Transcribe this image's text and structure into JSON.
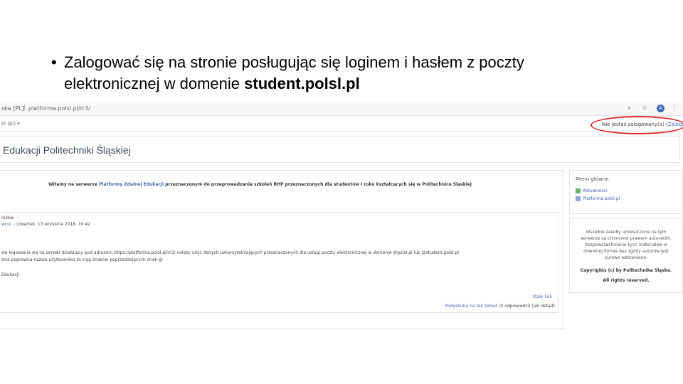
{
  "slide": {
    "bullet": "•",
    "line1": "Zalogować się na stronie posługując się loginem i hasłem z poczty",
    "line2_prefix": "elektronicznej w domenie ",
    "line2_bold": "student.polsl.pl"
  },
  "browser": {
    "lang_tab": "ska [PL]",
    "url": "platforma.polsl.pl/rr3/",
    "avatar_letter": "A"
  },
  "navbar": {
    "lang": "ki (pl) ▾",
    "login_text": "Nie jesteś zalogowany(a) (",
    "login_link": "Zaloguj się",
    "login_close": ")"
  },
  "header": {
    "title": "Edukacji Politechniki Śląskiej"
  },
  "main": {
    "welcome_prefix": "Witamy na serwerze ",
    "welcome_link": "Platformy Zdalnej Edukacji",
    "welcome_suffix": " przeznaczonym do przeprowadzania szkoleń BHP przeznaczonych dla studentów I roku kształcących się w Politechnice Śląskiej",
    "post_title": "ników",
    "post_author": "wroz",
    "post_date": " - czwartek, 13 września 2018, 10:42",
    "post_line1": "się logowania się na serwer działający pod adresem https://platforma.polsl.pl/rr3/ należy użyć danych uwierzytelniających przeznaczonych dla usługi poczty elektronicznej w domenie @polsl.pl lub @student.polsl.pl",
    "post_line2": "ście poprawna nazwa użytkownika to ciąg znaków poprzedzających znak @",
    "post_sign": "Edukacji",
    "permalink": "Stały link",
    "discuss_link": "Podyskutuj na ten temat",
    "discuss_count": " (0 odpowiedzi) (jak dotąd)"
  },
  "sidebar": {
    "menu_title": "Menu główne",
    "items": [
      "Aktualności",
      "Platforma.polsl.pl"
    ],
    "copyright_lines": [
      "Wszelkie zasoby umieszczone na tym",
      "serwerze są chronione prawem autorskim.",
      "Rozpowszechnianie tych materiałów w",
      "dowolnej formie bez zgody autorów jest",
      "surowo wzbronione."
    ],
    "copyright": "Copyrights (c) by Politechnika Śląska.",
    "rights": "All rights reserved."
  },
  "colors": {
    "accent": "#3f67b5",
    "highlight": "#e32b2b"
  }
}
